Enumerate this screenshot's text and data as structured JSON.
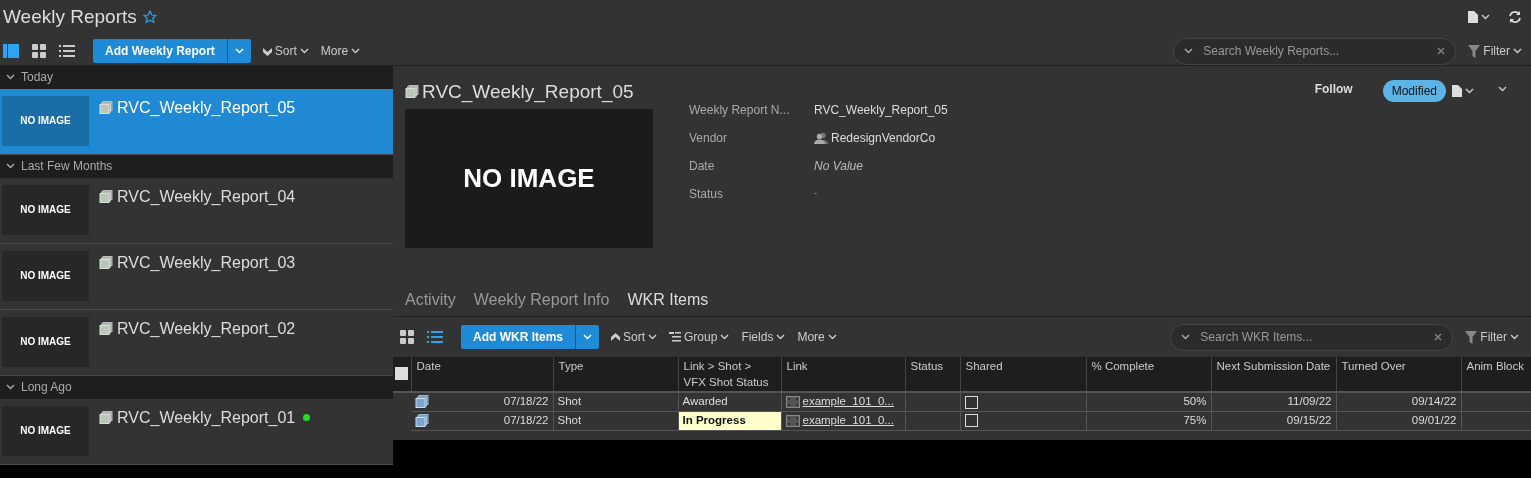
{
  "header": {
    "title": "Weekly Reports",
    "favorite": false,
    "view_modes": [
      {
        "kind": "split",
        "selected": true
      },
      {
        "kind": "grid",
        "selected": false
      },
      {
        "kind": "list",
        "selected": false
      }
    ],
    "add_button": "Add Weekly Report",
    "sort": "Sort",
    "more": "More",
    "search_placeholder": "Search Weekly Reports...",
    "filter": "Filter"
  },
  "groups": [
    {
      "label": "Today",
      "expanded": true,
      "items": [
        {
          "name": "RVC_Weekly_Report_05",
          "thumbnail": "NO IMAGE",
          "selected": true,
          "online": false
        }
      ]
    },
    {
      "label": "Last Few Months",
      "expanded": true,
      "items": [
        {
          "name": "RVC_Weekly_Report_04",
          "thumbnail": "NO IMAGE",
          "selected": false,
          "online": false
        },
        {
          "name": "RVC_Weekly_Report_03",
          "thumbnail": "NO IMAGE",
          "selected": false,
          "online": false
        },
        {
          "name": "RVC_Weekly_Report_02",
          "thumbnail": "NO IMAGE",
          "selected": false,
          "online": false
        }
      ]
    },
    {
      "label": "Long Ago",
      "expanded": true,
      "items": [
        {
          "name": "RVC_Weekly_Report_01",
          "thumbnail": "NO IMAGE",
          "selected": false,
          "online": true
        }
      ]
    }
  ],
  "detail": {
    "title": "RVC_Weekly_Report_05",
    "image_text": "NO IMAGE",
    "follow": "Follow",
    "status_badge": "Modified",
    "fields": [
      {
        "label": "Weekly Report N...",
        "value": "RVC_Weekly_Report_05",
        "kind": "text"
      },
      {
        "label": "Vendor",
        "value": "RedesignVendorCo",
        "kind": "vendor"
      },
      {
        "label": "Date",
        "value": "No Value",
        "kind": "novalue"
      },
      {
        "label": "Status",
        "value": "-",
        "kind": "dash"
      }
    ]
  },
  "tabs": [
    {
      "label": "Activity",
      "selected": false
    },
    {
      "label": "Weekly Report Info",
      "selected": false
    },
    {
      "label": "WKR Items",
      "selected": true
    }
  ],
  "toolbar": {
    "view_modes": [
      {
        "kind": "grid",
        "selected": false
      },
      {
        "kind": "list",
        "selected": true
      }
    ],
    "add_button": "Add WKR Items",
    "sort": "Sort",
    "group": "Group",
    "fields": "Fields",
    "more": "More",
    "search_placeholder": "Search WKR Items...",
    "filter": "Filter"
  },
  "table": {
    "all_selected": false,
    "columns": [
      "Date",
      "Type",
      "Link > Shot > VFX Shot Status",
      "Link",
      "Status",
      "Shared",
      "% Complete",
      "Next Submission Date",
      "Turned Over",
      "Anim Block"
    ],
    "rows": [
      {
        "date": "07/18/22",
        "type": "Shot",
        "vfx_status": "Awarded",
        "highlighted": false,
        "link": "example_101_0...",
        "shared": false,
        "complete": "50%",
        "next_submission": "11/09/22",
        "turned_over": "09/14/22"
      },
      {
        "date": "07/18/22",
        "type": "Shot",
        "vfx_status": "In Progress",
        "highlighted": true,
        "link": "example_101_0...",
        "shared": false,
        "complete": "75%",
        "next_submission": "09/15/22",
        "turned_over": "09/01/22"
      }
    ]
  }
}
